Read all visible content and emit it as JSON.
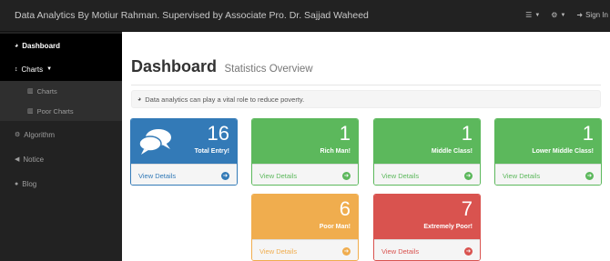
{
  "navbar": {
    "brand": "Data Analytics By Motiur Rahman. Supervised by Associate Pro. Dr. Sajjad Waheed",
    "sign_in": "Sign In"
  },
  "sidebar": {
    "items": [
      {
        "label": "Dashboard",
        "icon": "dashboard-icon"
      },
      {
        "label": "Charts",
        "icon": "sort-icon"
      },
      {
        "label": "Charts",
        "icon": "bar-chart-icon"
      },
      {
        "label": "Poor Charts",
        "icon": "bar-chart-icon"
      },
      {
        "label": "Algorithm",
        "icon": "cogs-icon"
      },
      {
        "label": "Notice",
        "icon": "bullhorn-icon"
      },
      {
        "label": "Blog",
        "icon": "info-circle-icon"
      }
    ]
  },
  "header": {
    "title": "Dashboard",
    "subtitle": "Statistics Overview"
  },
  "alert": {
    "text": "Data analytics can play a vital role to reduce poverty."
  },
  "panels": [
    {
      "value": "16",
      "label": "Total Entry!",
      "footer": "View Details",
      "color": "#337ab7"
    },
    {
      "value": "1",
      "label": "Rich Man!",
      "footer": "View Details",
      "color": "#5cb85c"
    },
    {
      "value": "1",
      "label": "Middle Class!",
      "footer": "View Details",
      "color": "#5cb85c"
    },
    {
      "value": "1",
      "label": "Lower Middle Class!",
      "footer": "View Details",
      "color": "#5cb85c"
    },
    {
      "value": "6",
      "label": "Poor Man!",
      "footer": "View Details",
      "color": "#f0ad4e"
    },
    {
      "value": "7",
      "label": "Extremely Poor!",
      "footer": "View Details",
      "color": "#d9534f"
    }
  ]
}
